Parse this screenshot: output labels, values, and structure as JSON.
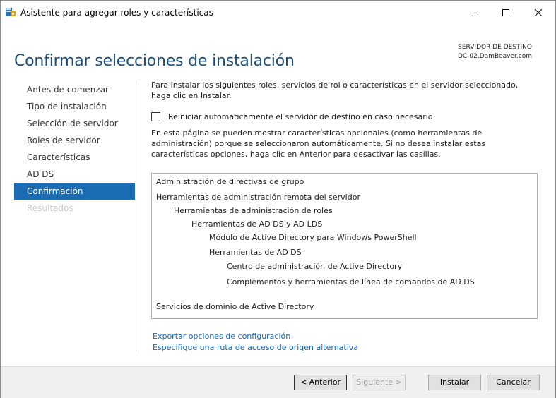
{
  "window": {
    "title": "Asistente para agregar roles y características",
    "icon": "server-manager-icon",
    "controls": {
      "minimize": "—",
      "maximize": "☐",
      "close": "✕"
    }
  },
  "header": {
    "title": "Confirmar selecciones de instalación",
    "dest_label": "SERVIDOR DE DESTINO",
    "dest_server": "DC-02.DamBeaver.com"
  },
  "nav": {
    "items": [
      {
        "label": "Antes de comenzar",
        "state": "normal"
      },
      {
        "label": "Tipo de instalación",
        "state": "normal"
      },
      {
        "label": "Selección de servidor",
        "state": "normal"
      },
      {
        "label": "Roles de servidor",
        "state": "normal"
      },
      {
        "label": "Características",
        "state": "normal"
      },
      {
        "label": "AD DS",
        "state": "normal"
      },
      {
        "label": "Confirmación",
        "state": "active"
      },
      {
        "label": "Resultados",
        "state": "disabled"
      }
    ]
  },
  "content": {
    "intro": "Para instalar los siguientes roles, servicios de rol o características en el servidor seleccionado, haga clic en Instalar.",
    "restart_checkbox": {
      "label": "Reiniciar automáticamente el servidor de destino en caso necesario",
      "checked": false
    },
    "note": "En esta página se pueden mostrar características opcionales (como herramientas de administración) porque se seleccionaron automáticamente. Si no desea instalar estas características opciones, haga clic en Anterior para desactivar las casillas.",
    "features": [
      {
        "label": "Administración de directivas de grupo",
        "level": 0
      },
      {
        "label": "Herramientas de administración remota del servidor",
        "level": 0
      },
      {
        "label": "Herramientas de administración de roles",
        "level": 1
      },
      {
        "label": "Herramientas de AD DS y AD LDS",
        "level": 2
      },
      {
        "label": "Módulo de Active Directory para Windows PowerShell",
        "level": 3
      },
      {
        "label": "Herramientas de AD DS",
        "level": 3
      },
      {
        "label": "Centro de administración de Active Directory",
        "level": 4
      },
      {
        "label": "Complementos y herramientas de línea de comandos de AD DS",
        "level": 4
      },
      {
        "label": "Servicios de dominio de Active Directory",
        "level": 0
      }
    ],
    "links": {
      "export": "Exportar opciones de configuración",
      "source": "Especifique una ruta de acceso de origen alternativa"
    }
  },
  "footer": {
    "back": "< Anterior",
    "next": "Siguiente >",
    "install": "Instalar",
    "cancel": "Cancelar"
  },
  "colors": {
    "accent": "#1b6cb3",
    "title": "#1e4f7a",
    "link": "#1a64b0"
  }
}
